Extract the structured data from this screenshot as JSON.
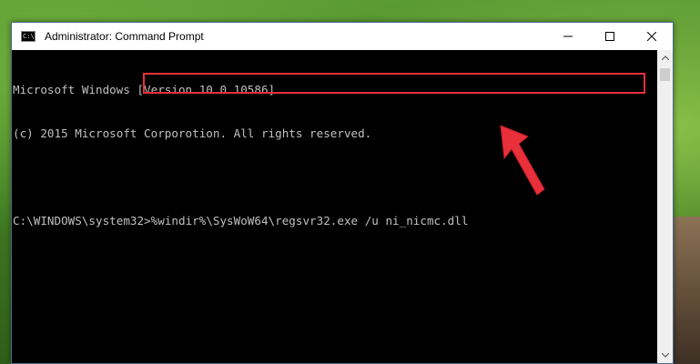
{
  "window": {
    "title": "Administrator: Command Prompt",
    "icon": "cmd-icon",
    "icon_text": "C:\\"
  },
  "controls": {
    "minimize": "minimize-icon",
    "maximize": "maximize-icon",
    "close": "close-icon"
  },
  "console": {
    "line1": "Microsoft Windows [Version 10.0.10586]",
    "line2": "(c) 2015 Microsoft Corporotion. All rights reserved.",
    "prompt": "C:\\WINDOWS\\system32>",
    "command": "%windir%\\SysWoW64\\regsvr32.exe /u ni_nicmc.dll"
  },
  "annotation": {
    "highlight_color": "#e8303a",
    "arrow_color": "#e8303a"
  },
  "colors": {
    "console_bg": "#000000",
    "console_text": "#c0c0c0",
    "titlebar_bg": "#ffffff"
  }
}
